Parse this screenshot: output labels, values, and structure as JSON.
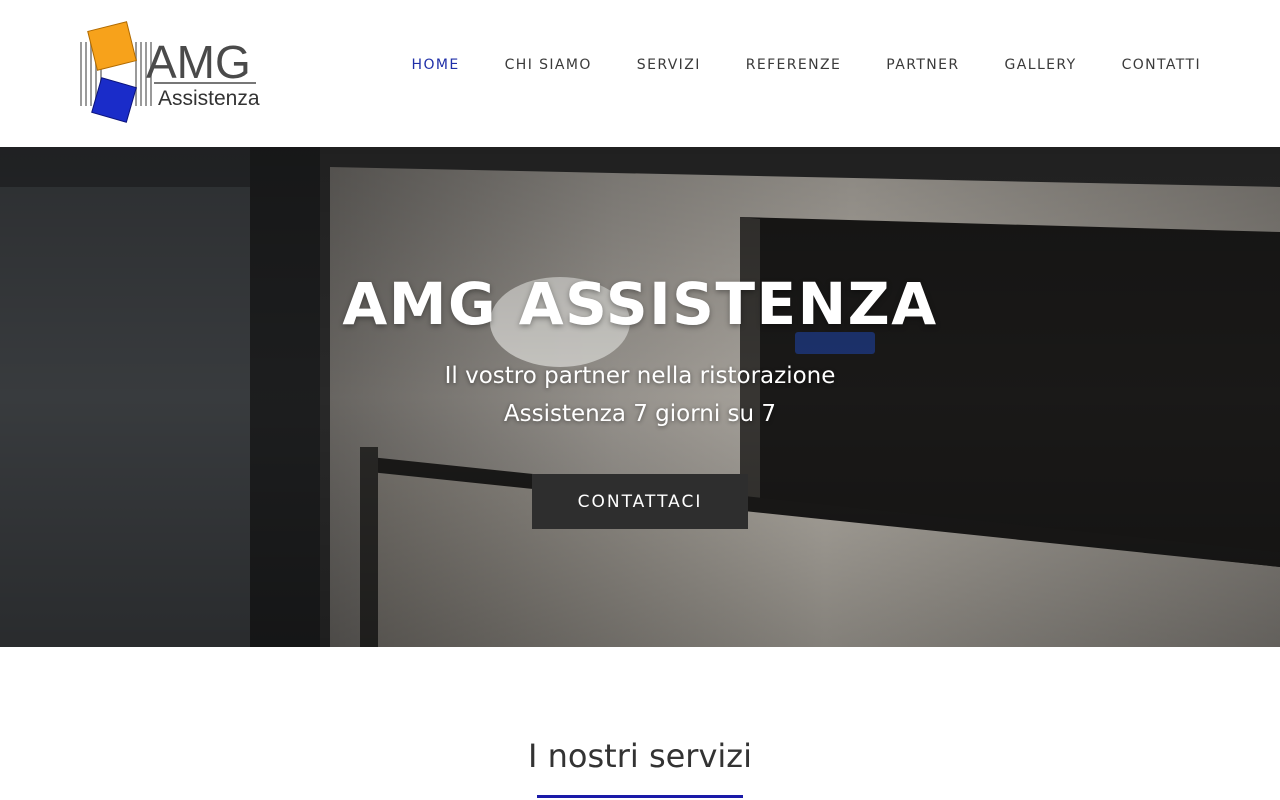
{
  "brand": {
    "logo_text_main": "AMG",
    "logo_text_sub": "Assistenza",
    "colors": {
      "orange": "#f7a21b",
      "blue": "#1a2cc9",
      "nav_active": "#1f2fa8"
    }
  },
  "nav": {
    "items": [
      {
        "label": "HOME",
        "active": true
      },
      {
        "label": "CHI SIAMO",
        "active": false
      },
      {
        "label": "SERVIZI",
        "active": false
      },
      {
        "label": "REFERENZE",
        "active": false
      },
      {
        "label": "PARTNER",
        "active": false
      },
      {
        "label": "GALLERY",
        "active": false
      },
      {
        "label": "CONTATTI",
        "active": false
      }
    ]
  },
  "hero": {
    "title": "AMG ASSISTENZA",
    "subtitle_line1": "Il vostro partner nella ristorazione",
    "subtitle_line2": "Assistenza 7 giorni su 7",
    "cta_label": "CONTATTACI"
  },
  "services": {
    "title": "I nostri servizi",
    "accent_color": "#1a1aa8"
  }
}
